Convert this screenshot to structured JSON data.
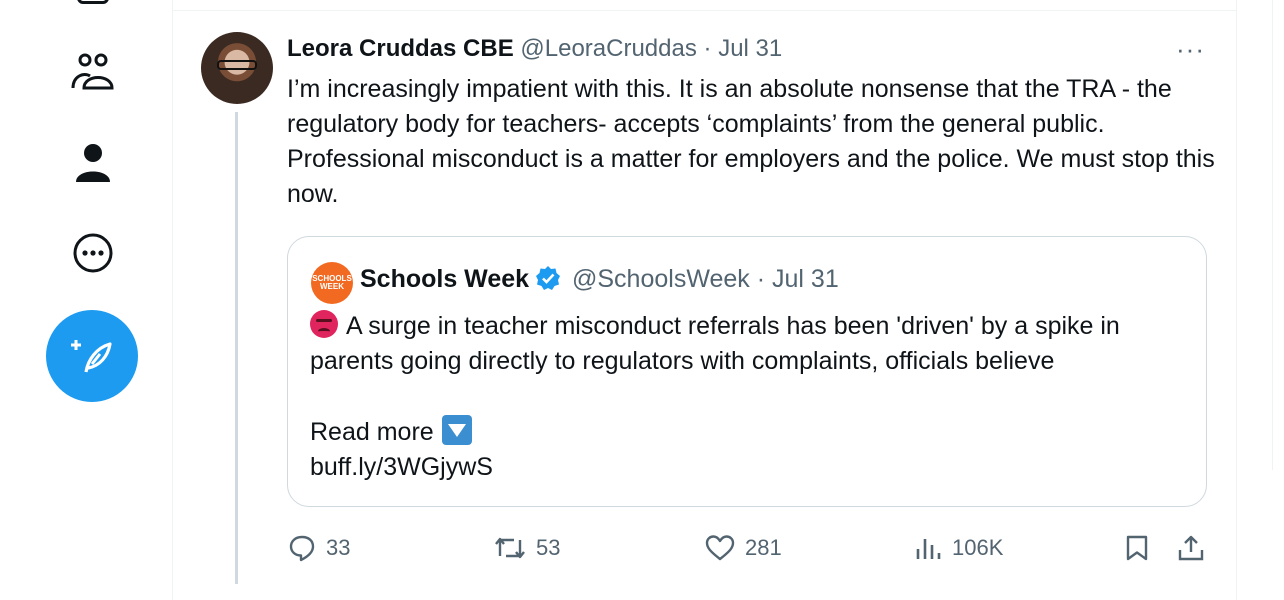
{
  "tweet": {
    "author_name": "Leora Cruddas CBE",
    "handle": "@LeoraCruddas",
    "separator": "·",
    "date": "Jul 31",
    "more": "···",
    "text": "I’m increasingly impatient with this. It is an absolute nonsense that the TRA - the regulatory body for teachers- accepts ‘complaints’ from the general public. Professional misconduct is a matter for employers and the police. We must stop this now."
  },
  "quote": {
    "avatar_text": "SCHOOLS WEEK",
    "author_name": "Schools Week",
    "handle": "@SchoolsWeek",
    "separator": "·",
    "date": "Jul 31",
    "text": "A surge in teacher misconduct referrals has been 'driven' by a spike in parents going directly to regulators with complaints, officials believe",
    "read_more": "Read more",
    "link": "buff.ly/3WGjywS"
  },
  "actions": {
    "replies": "33",
    "reposts": "53",
    "likes": "281",
    "views": "106K"
  },
  "colors": {
    "accent": "#1d9bf0",
    "secondary_text": "#536471",
    "border": "#cfd9de",
    "schools_week_orange": "#f26a21"
  },
  "icons": [
    "communities-icon",
    "profile-icon",
    "more-circle-icon",
    "compose-icon",
    "reply-icon",
    "repost-icon",
    "like-icon",
    "views-icon",
    "bookmark-icon",
    "share-icon",
    "verified-badge-icon"
  ]
}
